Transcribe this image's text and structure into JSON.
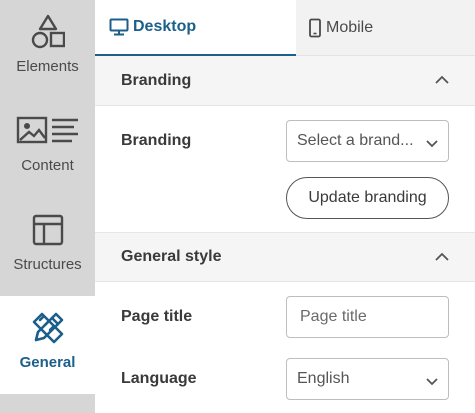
{
  "sidebar": {
    "items": [
      {
        "label": "Elements",
        "icon": "shapes-icon"
      },
      {
        "label": "Content",
        "icon": "image-text-icon"
      },
      {
        "label": "Structures",
        "icon": "layout-icon"
      },
      {
        "label": "General",
        "icon": "pencil-ruler-icon",
        "active": true
      }
    ]
  },
  "tabs": [
    {
      "label": "Desktop",
      "icon": "monitor-icon",
      "active": true
    },
    {
      "label": "Mobile",
      "icon": "mobile-icon",
      "active": false
    }
  ],
  "branding_section": {
    "title": "Branding",
    "branding_label": "Branding",
    "branding_select_value": "Select a brand...",
    "update_button": "Update branding"
  },
  "general_style_section": {
    "title": "General style",
    "page_title_label": "Page title",
    "page_title_placeholder": "Page title",
    "language_label": "Language",
    "language_value": "English"
  },
  "colors": {
    "accent": "#1b5f8a",
    "sidebar_bg": "#d6d6d6",
    "section_bg": "#f5f5f5"
  }
}
